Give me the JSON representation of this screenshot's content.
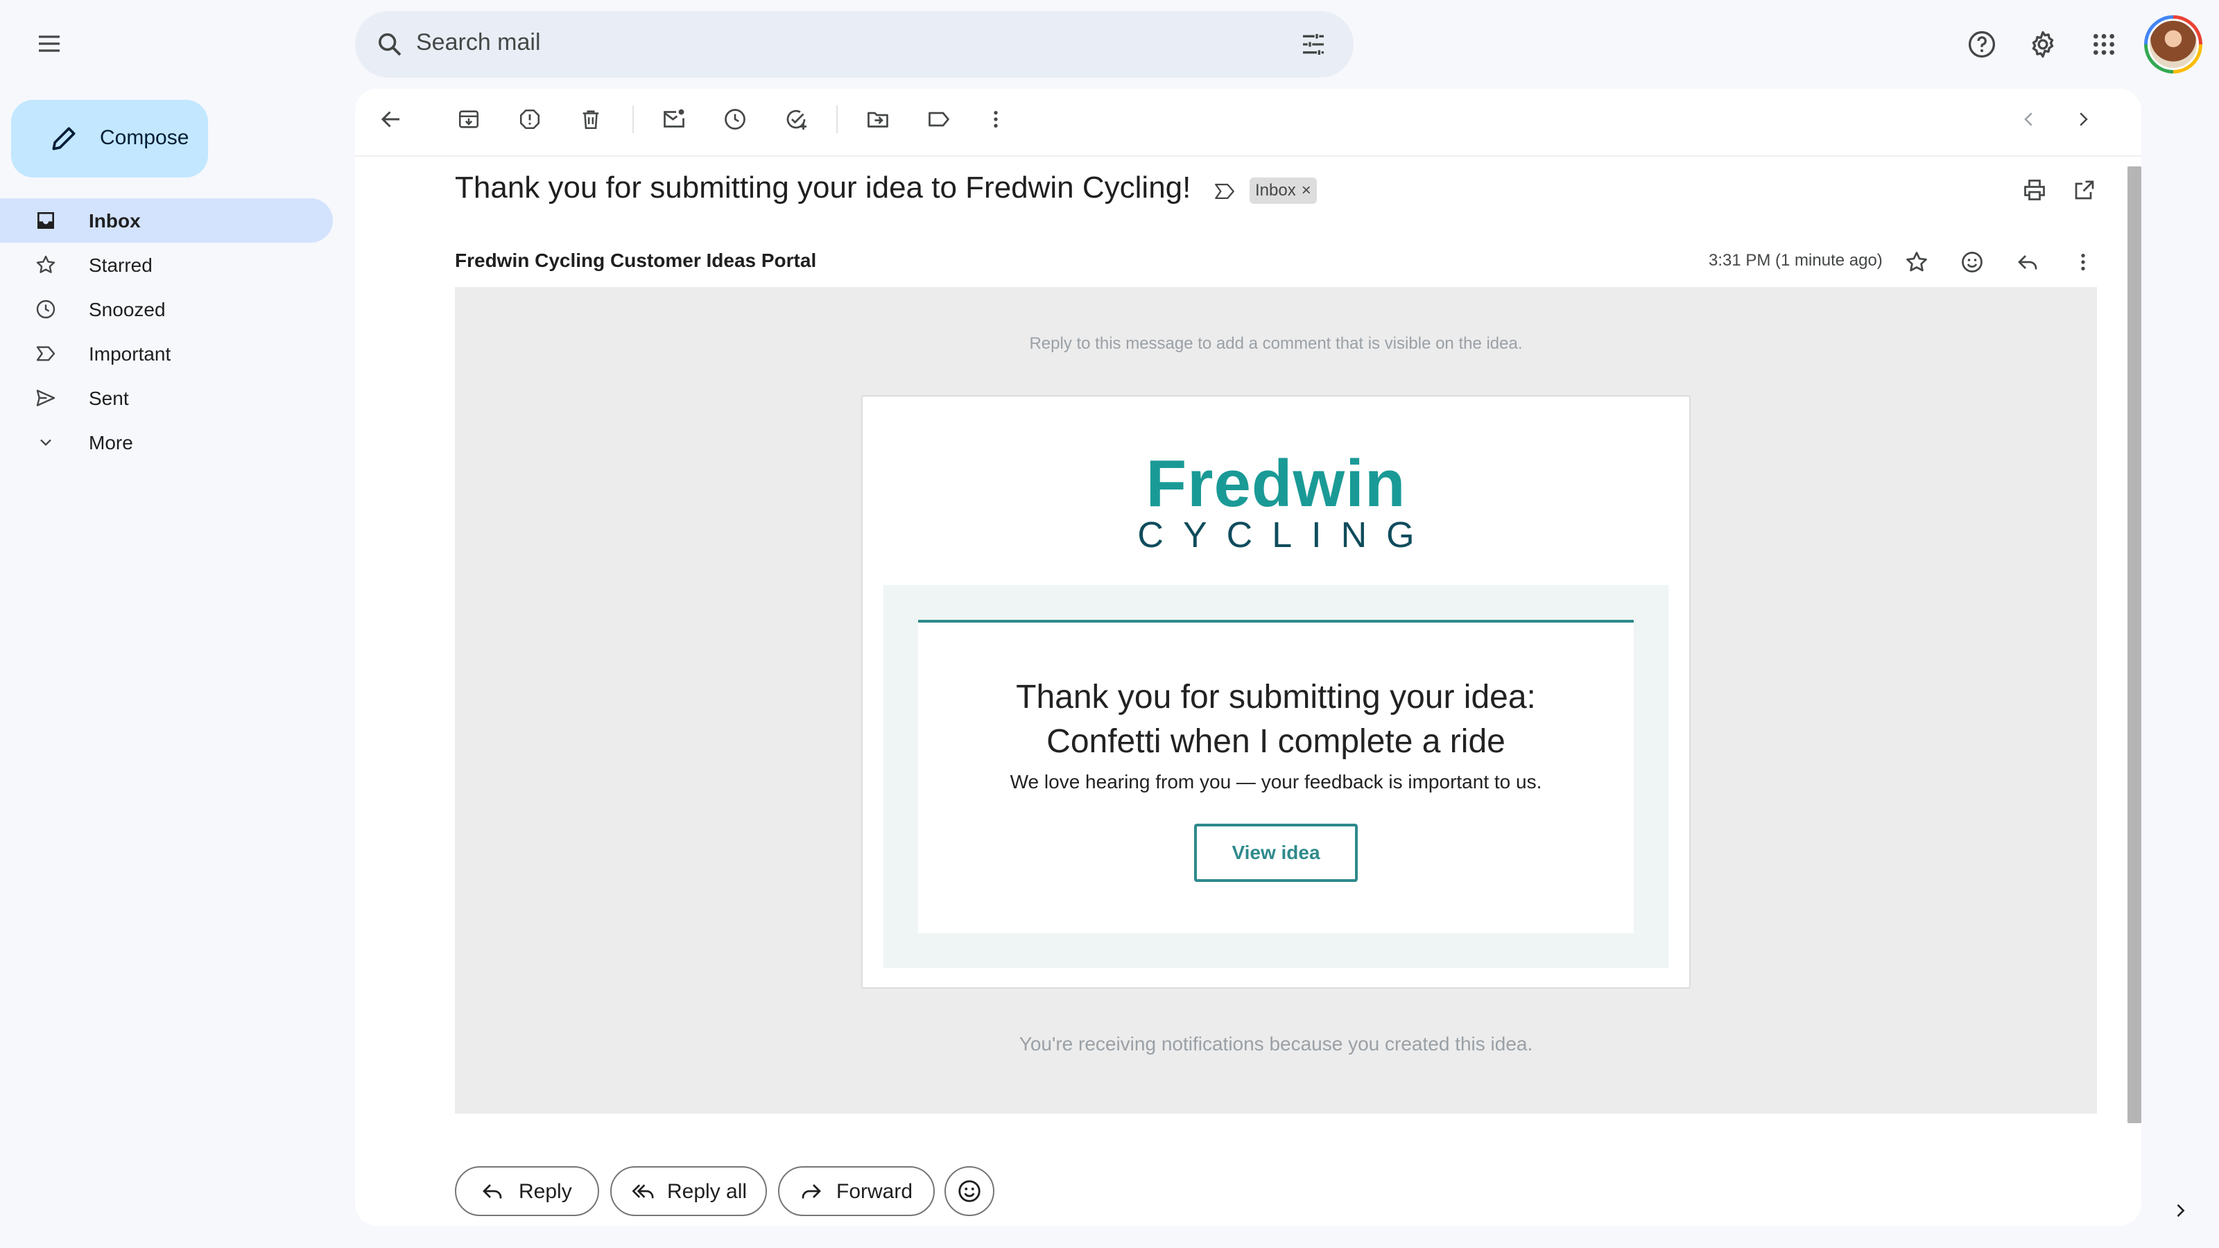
{
  "search": {
    "placeholder": "Search mail"
  },
  "compose": {
    "label": "Compose"
  },
  "sidebar": {
    "items": [
      {
        "label": "Inbox",
        "icon": "inbox-icon",
        "active": true
      },
      {
        "label": "Starred",
        "icon": "star-icon"
      },
      {
        "label": "Snoozed",
        "icon": "clock-icon"
      },
      {
        "label": "Important",
        "icon": "important-icon"
      },
      {
        "label": "Sent",
        "icon": "send-icon"
      },
      {
        "label": "More",
        "icon": "chevron-down-icon"
      }
    ]
  },
  "message": {
    "subject": "Thank you for submitting your idea to Fredwin Cycling!",
    "label_chip": "Inbox",
    "sender": "Fredwin Cycling Customer Ideas Portal",
    "time": "3:31 PM (1 minute ago)"
  },
  "email": {
    "reply_note": "Reply to this message to add a comment that is visible on the idea.",
    "logo_main": "Fredwin",
    "logo_sub": "CYCLING",
    "headline_1": "Thank you for submitting your idea:",
    "headline_2": "Confetti when I complete a ride",
    "subline": "We love hearing from you — your feedback is important to us.",
    "button": "View idea",
    "footer_note": "You're receiving notifications because you created this idea."
  },
  "actions": {
    "reply": "Reply",
    "reply_all": "Reply all",
    "forward": "Forward"
  },
  "colors": {
    "brand_teal": "#1a9a96",
    "compose_bg": "#c2e7ff",
    "active_nav": "#d3e3fd"
  }
}
